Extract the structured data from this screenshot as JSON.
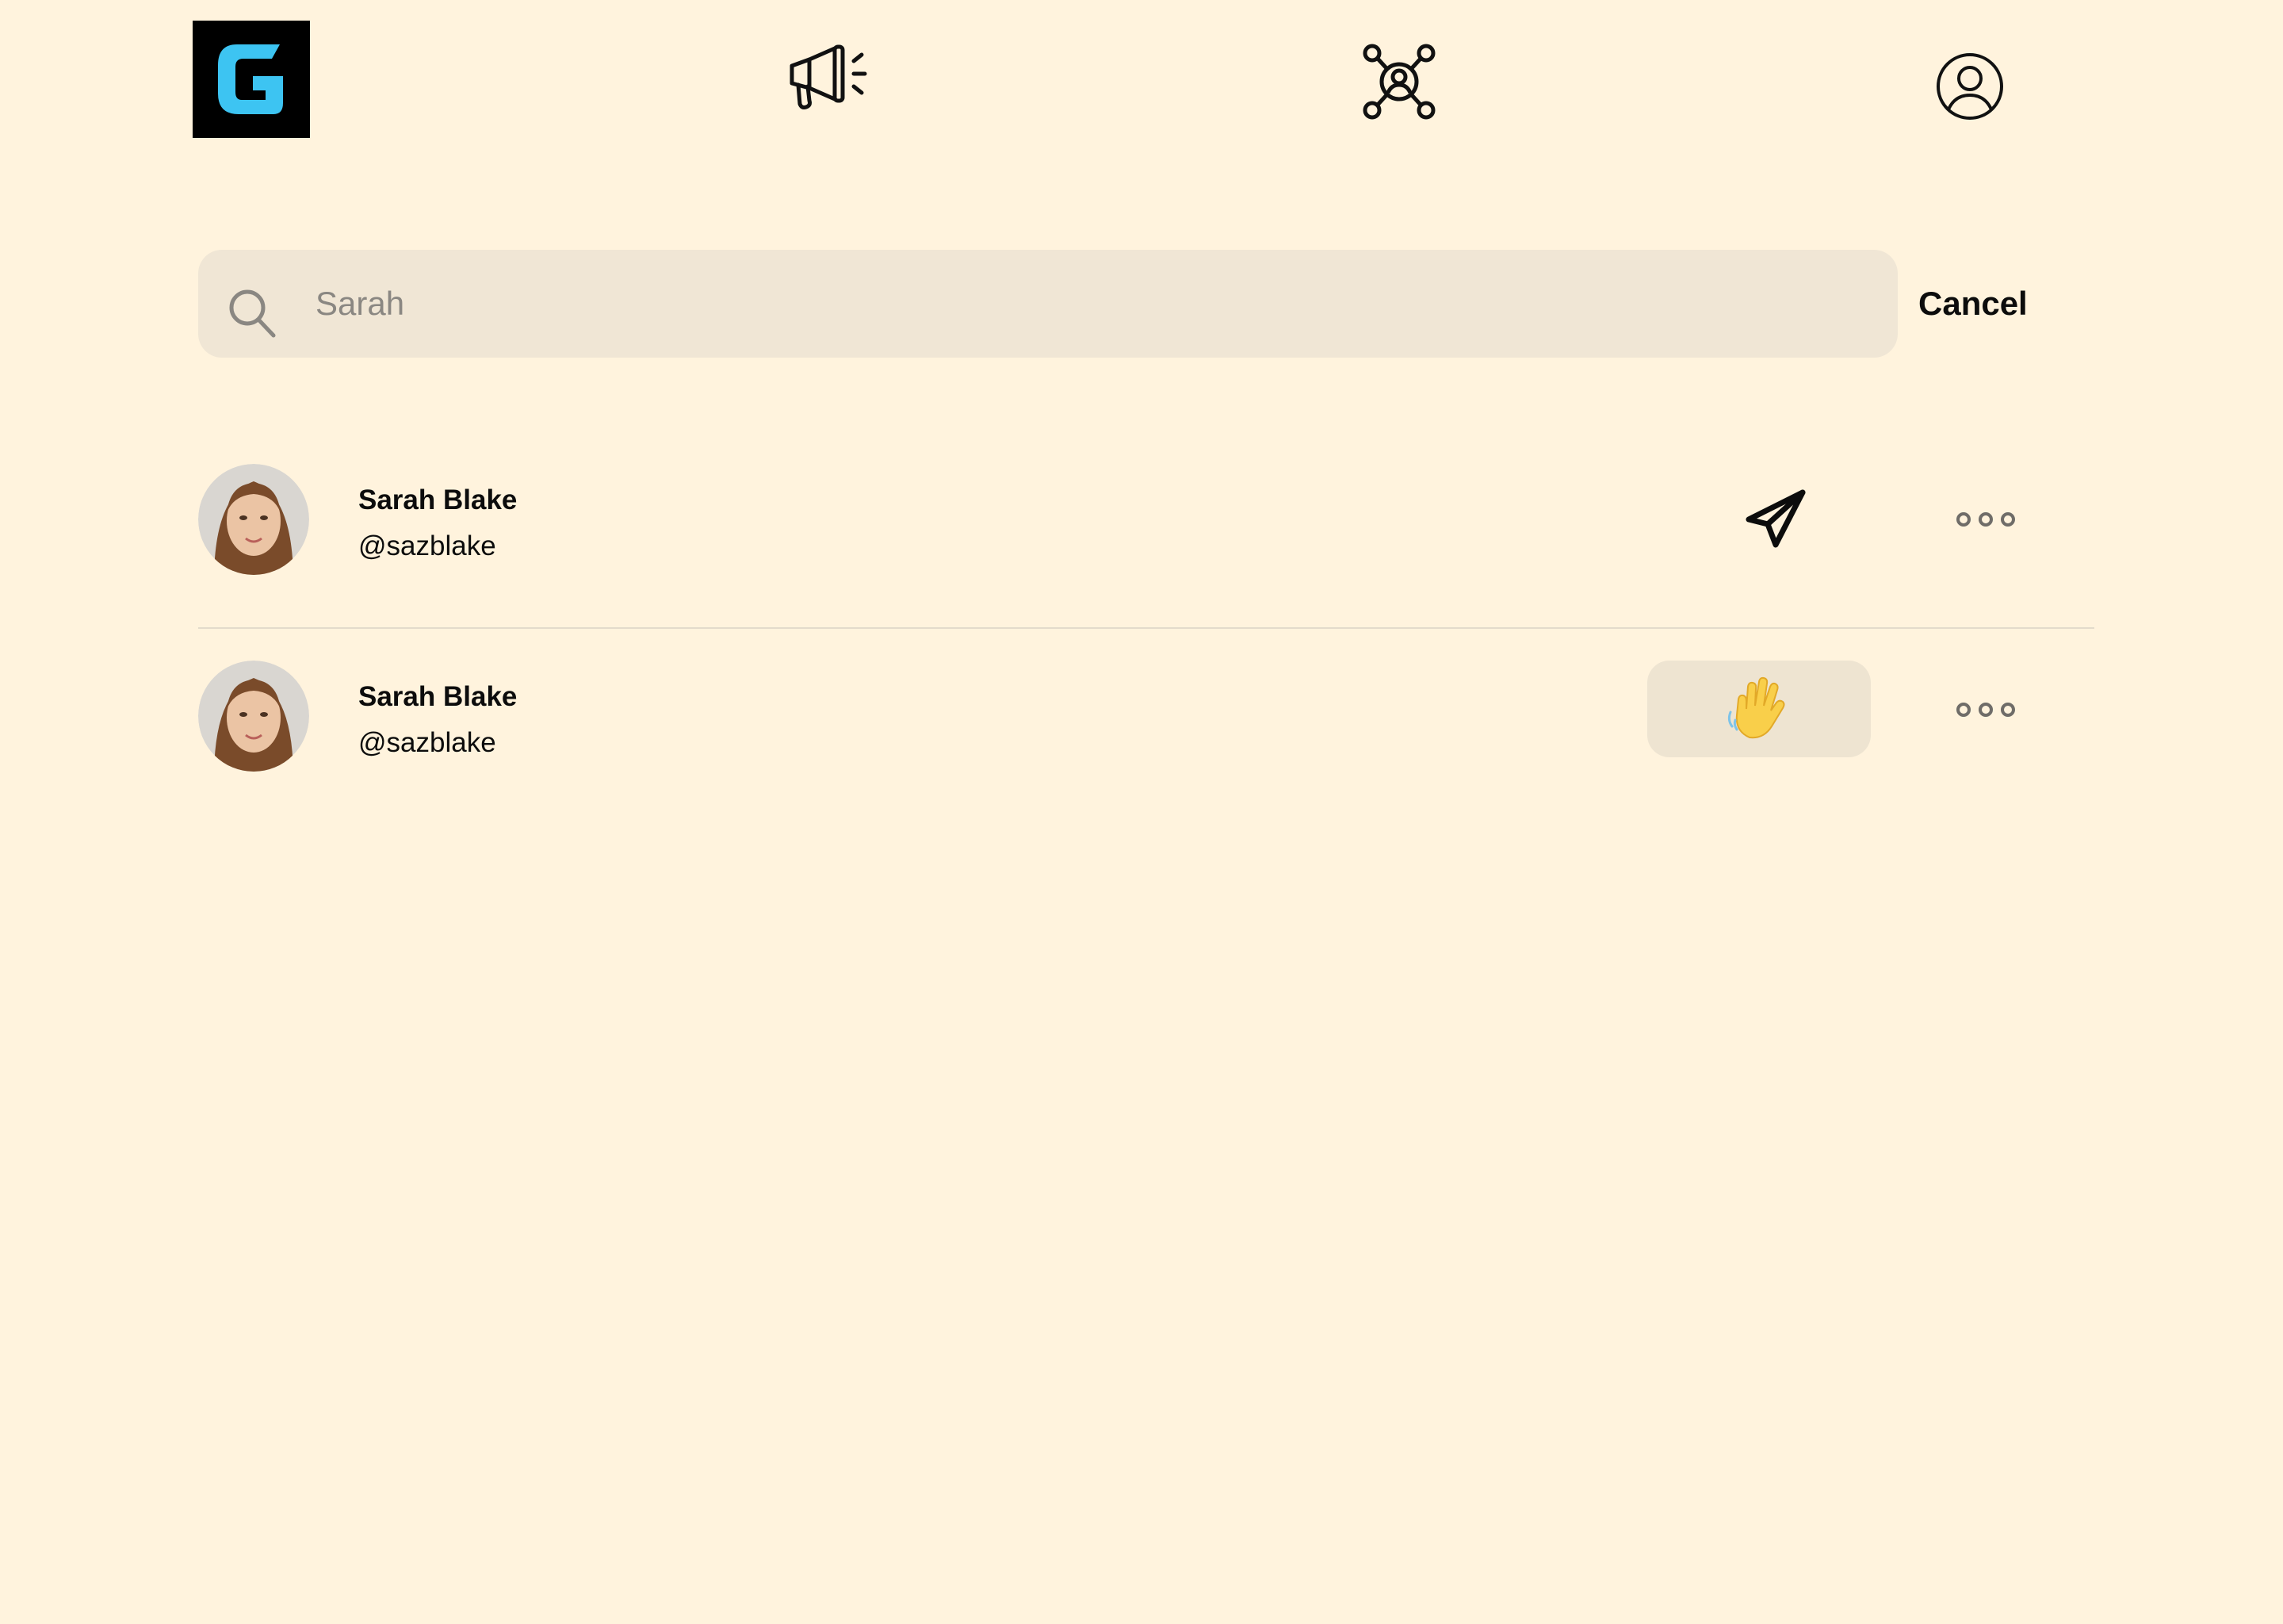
{
  "nav": {
    "logo_icon": "g-logo-icon",
    "items": [
      {
        "name": "news",
        "icon": "megaphone-icon"
      },
      {
        "name": "network",
        "icon": "network-icon"
      },
      {
        "name": "profile",
        "icon": "user-circle-icon"
      }
    ]
  },
  "search": {
    "value": "",
    "placeholder": "Sarah",
    "icon": "search-icon",
    "cancel_label": "Cancel"
  },
  "results": [
    {
      "name": "Sarah Blake",
      "handle": "@sazblake",
      "action_icon": "send-icon",
      "more_icon": "more-icon"
    },
    {
      "name": "Sarah Blake",
      "handle": "@sazblake",
      "action_icon": "wave-icon",
      "more_icon": "more-icon"
    }
  ],
  "colors": {
    "background": "#FFF3DD",
    "search_bg": "#F0E6D5",
    "wave_bg": "#EEE4D1",
    "logo_blue": "#3DC4F2",
    "text": "#0c0c0c",
    "muted": "#8a8782"
  }
}
